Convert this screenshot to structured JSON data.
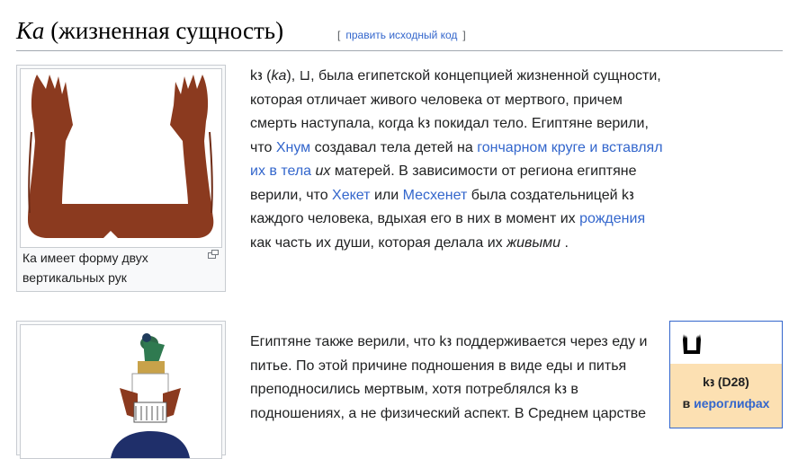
{
  "heading": {
    "title_italic": "Ка",
    "title_rest": " (жизненная сущность)",
    "edit_open": "[",
    "edit_link": "править исходный код",
    "edit_close": "]"
  },
  "figure1": {
    "caption": "Ка имеет форму двух вертикальных рук",
    "icon": "enlarge-icon",
    "colors": {
      "arm": "#8b3a1f"
    }
  },
  "paragraph1": {
    "s1": "kꜣ (",
    "s2": "ka",
    "s3": "), ",
    "glyph": "⊔",
    "s4": ", была египетской концепцией жизненной сущности, которая отличает живого человека от мертвого, причем смерть наступала, когда kꜣ покидал тело. Египтяне верили, что ",
    "link_khnum": "Хнум",
    "s5": " создавал тела детей на ",
    "link_wheel": "гончарном круге и вставлял их в тела",
    "s6": " ",
    "s7": "их",
    "s8": " матерей. В зависимости от региона египтяне верили, что ",
    "link_heqet": "Хекет",
    "s9": " или ",
    "link_meskhenet": "Месхенет",
    "s10": " была создательницей kꜣ каждого человека, вдыхая его в них в момент их ",
    "link_birth": "рождения",
    "s11": " как часть их души, которая делала их ",
    "s12": "живыми",
    "s13": " ."
  },
  "paragraph2": {
    "text": "Египтяне также верили, что kꜣ поддерживается через еду и питье. По этой причине подношения в виде еды и питья преподносились мертвым, хотя потреблялся kꜣ в подношениях, а не физический аспект. В Среднем царстве"
  },
  "hieroglyph_box": {
    "code": "kꜣ (D28)",
    "in": "в ",
    "link": "иероглифах",
    "colors": {
      "lower_bg": "#fce0b2",
      "border": "#3366cc"
    }
  }
}
